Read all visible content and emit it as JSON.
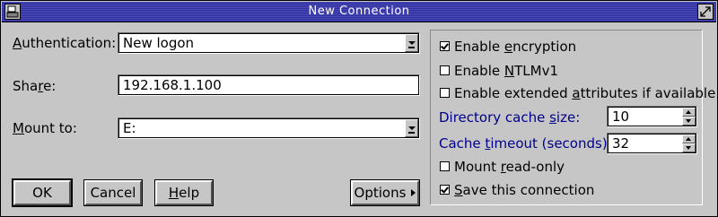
{
  "window": {
    "title": "New Connection",
    "sysmenu_icon": "system-menu-icon",
    "max_icon": "maximize-icon"
  },
  "left": {
    "authentication": {
      "label_pre": "",
      "label_accel": "A",
      "label_post": "uthentication:",
      "value": "New logon"
    },
    "share": {
      "label_pre": "Sha",
      "label_accel": "r",
      "label_post": "e:",
      "value": "192.168.1.100"
    },
    "mount": {
      "label_pre": "",
      "label_accel": "M",
      "label_post": "ount to:",
      "value": "E:"
    }
  },
  "buttons": {
    "ok": {
      "label": "OK"
    },
    "cancel": {
      "label": "Cancel"
    },
    "help": {
      "pre": "",
      "accel": "H",
      "post": "elp"
    },
    "options": {
      "label": "Options"
    }
  },
  "right": {
    "enable_encryption": {
      "pre": "Enable ",
      "accel": "e",
      "post": "ncryption",
      "checked": true
    },
    "enable_ntlmv1": {
      "pre": "Enable ",
      "accel": "N",
      "post": "TLMv1",
      "checked": false
    },
    "enable_ext_attr": {
      "pre": "Enable extended ",
      "accel": "a",
      "post": "ttributes if available",
      "checked": false
    },
    "dir_cache_size": {
      "pre": "Directory cache ",
      "accel": "s",
      "post": "ize:",
      "value": "10"
    },
    "cache_timeout": {
      "pre": "Cache ",
      "accel": "t",
      "post": "imeout (seconds):",
      "value": "32"
    },
    "mount_readonly": {
      "pre": "Mount ",
      "accel": "r",
      "post": "ead-only",
      "checked": false
    },
    "save_connection": {
      "pre": "",
      "accel": "S",
      "post": "ave this connection",
      "checked": true
    }
  },
  "colors": {
    "face": "#c6c6c6",
    "title_bg": "#3a3aa8",
    "blue_label": "#00008b"
  }
}
